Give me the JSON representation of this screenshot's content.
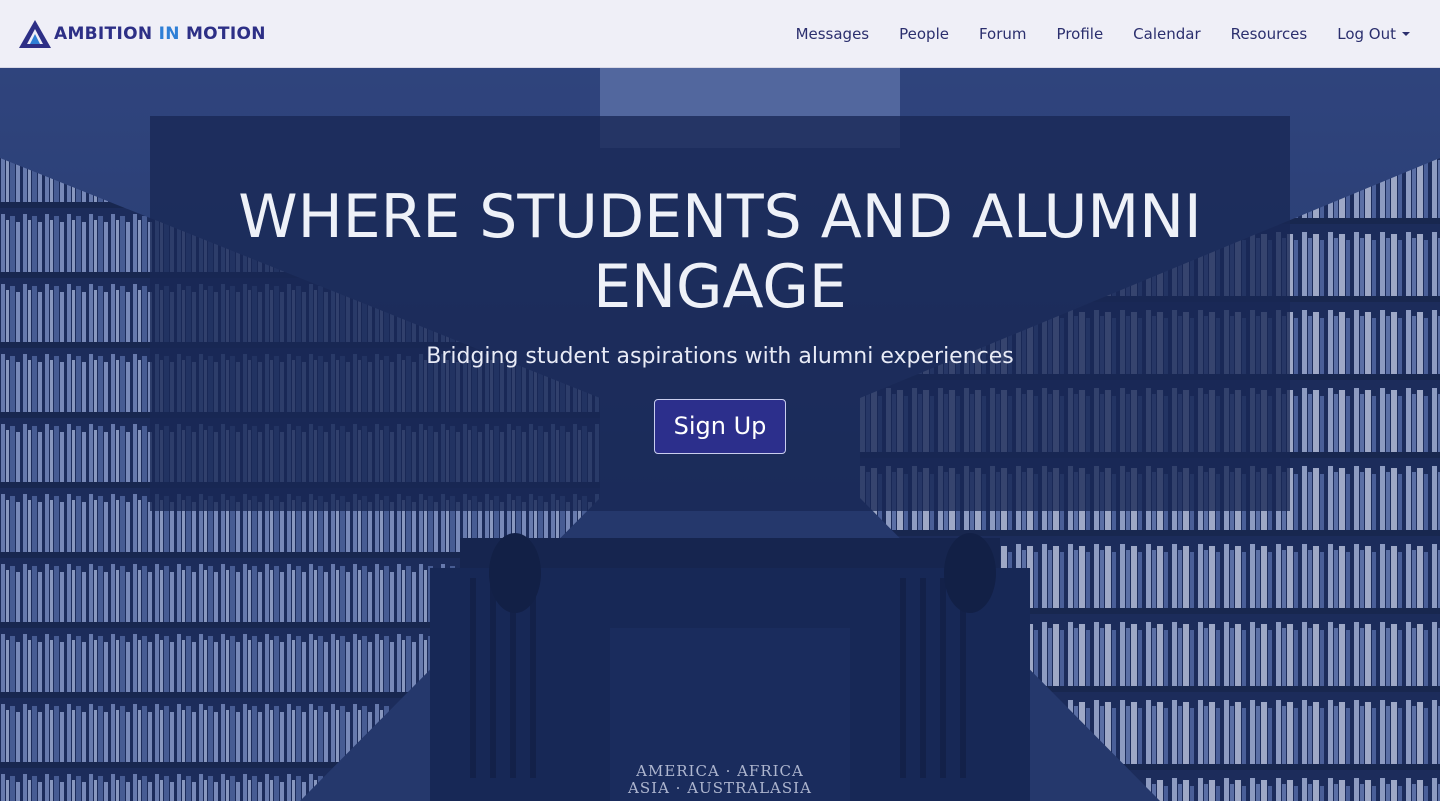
{
  "navbar": {
    "brand": {
      "word1": "AMBITION",
      "word2": "IN",
      "word3": "MOTION"
    },
    "items": [
      {
        "label": "Messages"
      },
      {
        "label": "People"
      },
      {
        "label": "Forum"
      },
      {
        "label": "Profile"
      },
      {
        "label": "Calendar"
      },
      {
        "label": "Resources"
      },
      {
        "label": "Log Out"
      }
    ]
  },
  "hero": {
    "title_line1": "WHERE STUDENTS AND ALUMNI",
    "title_line2": "ENGAGE",
    "subtitle": "Bridging student aspirations with alumni experiences",
    "cta_label": "Sign Up",
    "floor_line1": "AMERICA  ·  AFRICA",
    "floor_line2": "ASIA  ·  AUSTRALASIA"
  },
  "colors": {
    "brand_primary": "#2d2f86",
    "brand_accent": "#2e7fd6",
    "nav_bg": "#efeff7",
    "hero_panel": "#182854",
    "button_bg": "#2c2f8c"
  }
}
